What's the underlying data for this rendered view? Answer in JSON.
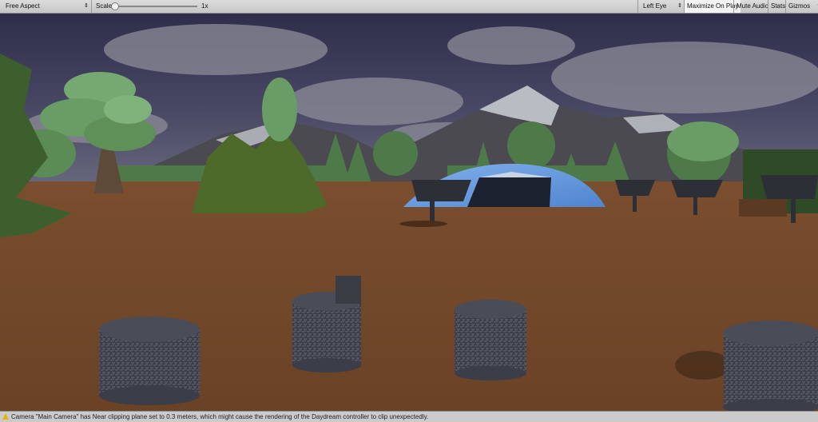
{
  "toolbar": {
    "aspect": "Free Aspect",
    "scale_label": "Scale",
    "scale_value": "1x",
    "eye": "Left Eye",
    "maximize_on_play": "Maximize On Play",
    "mute_audio": "Mute Audio",
    "stats": "Stats",
    "gizmos": "Gizmos",
    "dropdown_glyph": "▾",
    "spinner_glyph": "⇕"
  },
  "status": {
    "message": "Camera \"Main Camera\" has Near clipping plane set to 0.3 meters, which might cause the rendering of the Daydream controller to clip unexpectedly."
  },
  "colors": {
    "ground": "#6f4628",
    "sky": "#3b3b56",
    "dome": "#5b8fd6",
    "tree": "#5f8f55",
    "warning": "#e3b400"
  }
}
